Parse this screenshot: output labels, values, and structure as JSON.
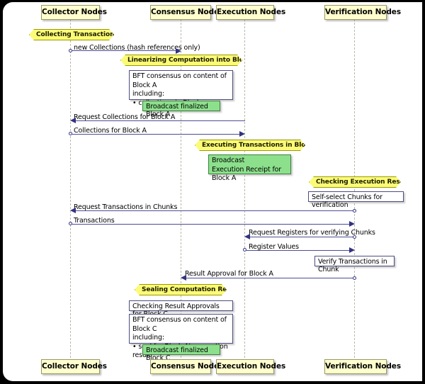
{
  "diagram": {
    "type": "uml-sequence-diagram",
    "colors": {
      "participant_fill": "#FEFECE",
      "participant_border": "#999966",
      "divider_fill": "#FBFB77",
      "divider_border": "#999900",
      "note_fill": "#FFFFFF",
      "note_border": "#4D4D80",
      "broadcast_note_fill": "#8CE08C",
      "arrow_color": "#33337F",
      "lifeline_color": "#B8B8A8",
      "canvas": "#FFFFFF",
      "frame": "#000000"
    },
    "participants": [
      {
        "id": "collector",
        "label": "Collector Nodes"
      },
      {
        "id": "consensus",
        "label": "Consensus Nodes"
      },
      {
        "id": "execution",
        "label": "Execution Nodes"
      },
      {
        "id": "verification",
        "label": "Verification Nodes"
      }
    ],
    "participants_footer": [
      {
        "id": "collector",
        "label": "Collector Nodes"
      },
      {
        "id": "consensus",
        "label": "Consensus Nodes"
      },
      {
        "id": "execution",
        "label": "Execution Nodes"
      },
      {
        "id": "verification",
        "label": "Verification Nodes"
      }
    ],
    "dividers": [
      {
        "id": "collecting-transactions",
        "label": "Collecting Transactions"
      },
      {
        "id": "linearizing-computation",
        "label": "Linearizing Computation into Blocks"
      },
      {
        "id": "executing-transactions",
        "label": "Executing Transactions in Block A"
      },
      {
        "id": "checking-execution",
        "label": "Checking Execution Result"
      },
      {
        "id": "sealing-computation",
        "label": "Sealing Computation Result"
      }
    ],
    "messages": [
      {
        "id": "new-collections",
        "label": "new Collections (hash references only)",
        "from": "collector",
        "to": "consensus"
      },
      {
        "id": "request-collections",
        "label": "Request Collections for Block A",
        "from": "execution",
        "to": "collector"
      },
      {
        "id": "collections-for-block",
        "label": "Collections for Block A",
        "from": "collector",
        "to": "execution"
      },
      {
        "id": "request-transactions",
        "label": "Request Transactions in Chunks",
        "from": "verification",
        "to": "collector"
      },
      {
        "id": "transactions",
        "label": "Transactions",
        "from": "collector",
        "to": "verification"
      },
      {
        "id": "request-registers",
        "label": "Request Registers for verifying Chunks",
        "from": "verification",
        "to": "execution"
      },
      {
        "id": "register-values",
        "label": "Register Values",
        "from": "execution",
        "to": "verification"
      },
      {
        "id": "result-approval",
        "label": "Result Approval for Block A",
        "from": "verification",
        "to": "consensus"
      }
    ],
    "notes": [
      {
        "id": "bft-consensus-block-a",
        "text": "BFT consensus on content of Block A\nincluding:\n • collections in Block",
        "style": "plain",
        "over": "consensus"
      },
      {
        "id": "broadcast-finalized-block-a",
        "text": "Broadcast finalized Block A",
        "style": "green",
        "over": "consensus"
      },
      {
        "id": "broadcast-execution-receipt",
        "text": "Broadcast\nExecution Receipt for Block A",
        "style": "green",
        "over": "execution"
      },
      {
        "id": "self-select-chunks",
        "text": "Self-select Chunks for verification",
        "style": "plain",
        "over": "verification"
      },
      {
        "id": "verify-transactions-in-chunk",
        "text": "Verify Transactions in Chunk",
        "style": "plain",
        "over": "verification"
      },
      {
        "id": "checking-result-approvals",
        "text": "Checking Result Approvals for Block C",
        "style": "plain",
        "over": "consensus"
      },
      {
        "id": "bft-consensus-block-c",
        "text": "BFT consensus on content of Block C\nincluding:\n • seal for Block A's execution result",
        "style": "plain",
        "over": "consensus"
      },
      {
        "id": "broadcast-finalized-block-c",
        "text": "Broadcast finalized Block C",
        "style": "green",
        "over": "consensus"
      }
    ]
  }
}
